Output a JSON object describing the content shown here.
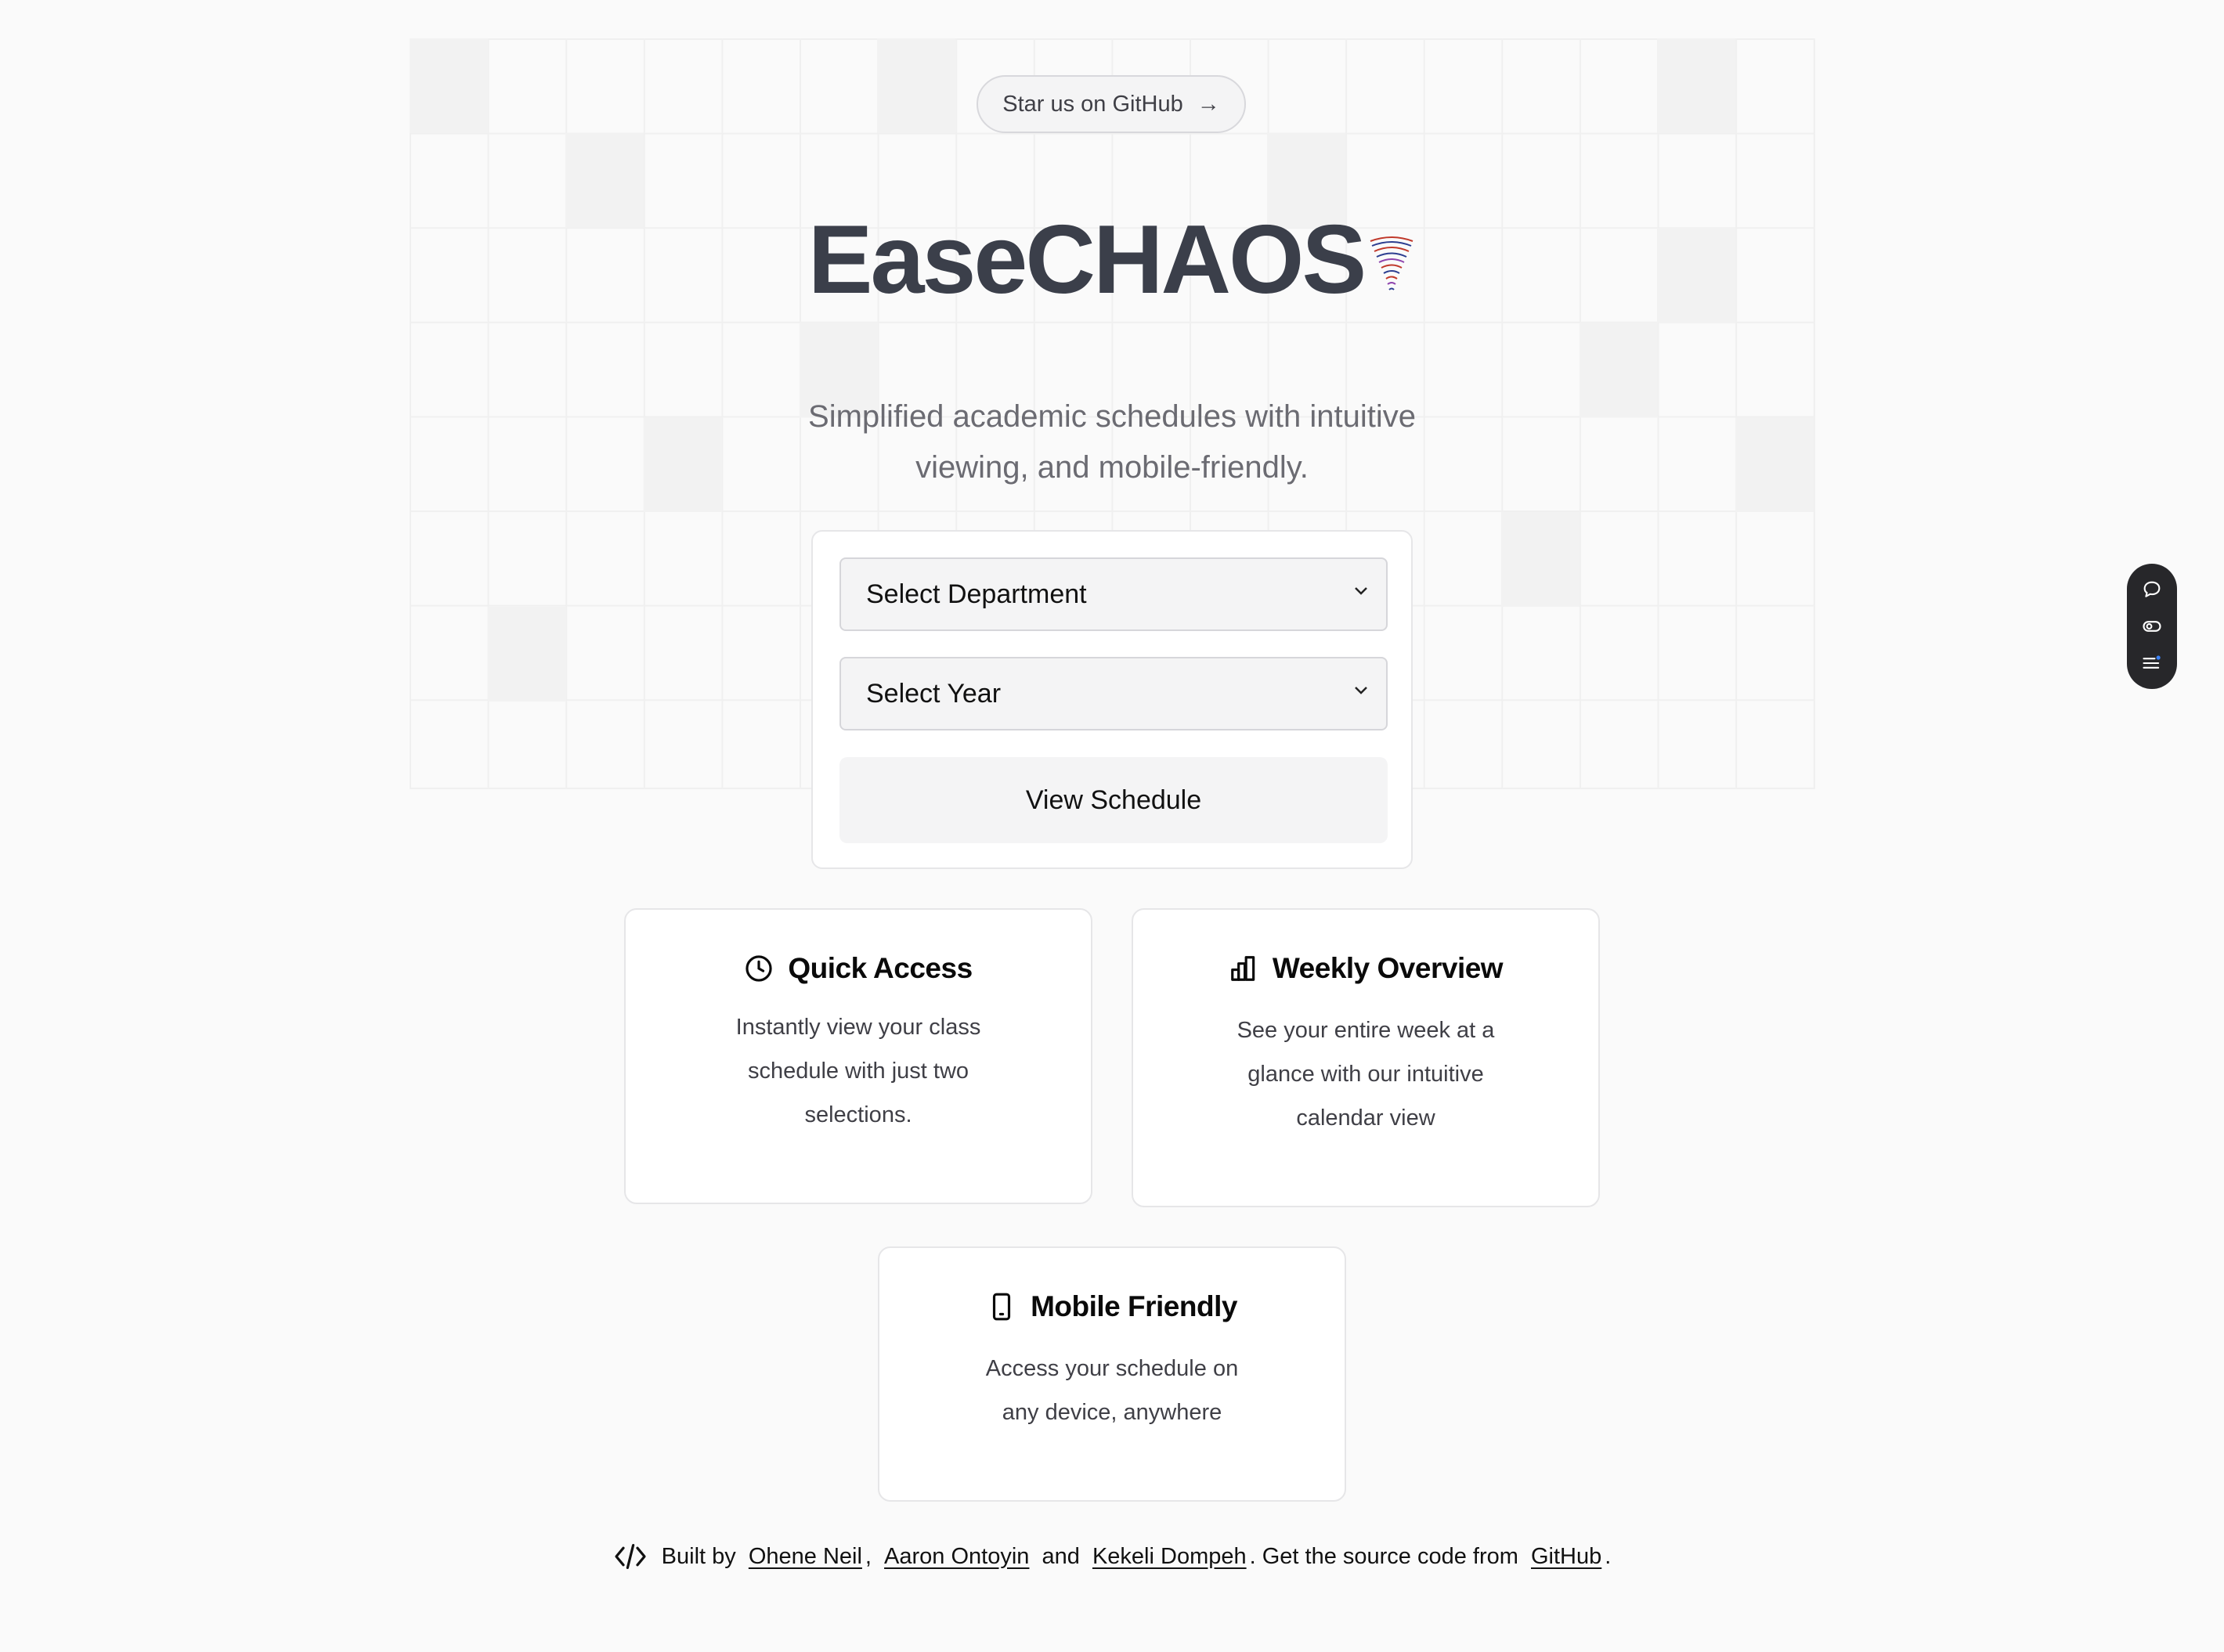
{
  "header": {
    "github_pill_label": "Star us on GitHub",
    "github_pill_arrow": "→",
    "title": "EaseCHAOS",
    "subtitle_line1": "Simplified academic schedules with intuitive",
    "subtitle_line2": "viewing, and mobile-friendly."
  },
  "form": {
    "department_select": "Select Department",
    "year_select": "Select Year",
    "view_button": "View Schedule"
  },
  "features": [
    {
      "title": "Quick Access",
      "icon": "clock-icon",
      "lines": [
        "Instantly view your class",
        "schedule with just two",
        "selections."
      ]
    },
    {
      "title": "Weekly Overview",
      "icon": "bar-chart-icon",
      "lines": [
        "See your entire week at a",
        "glance with our intuitive",
        "calendar view"
      ]
    },
    {
      "title": "Mobile Friendly",
      "icon": "smartphone-icon",
      "lines": [
        "Access your schedule on",
        "any device, anywhere"
      ]
    }
  ],
  "footer": {
    "prefix": "Built by",
    "author1": "Ohene Neil",
    "sep1": ",",
    "author2": "Aaron Ontoyin",
    "and": "and",
    "author3": "Kekeli Dompeh",
    "source_text": ". Get the source code from",
    "github_link": "GitHub",
    "end": "."
  },
  "colors": {
    "background": "#fafafa",
    "title": "#3b3f4a",
    "subtitle": "#6b6b72",
    "widget": "#27272a"
  }
}
